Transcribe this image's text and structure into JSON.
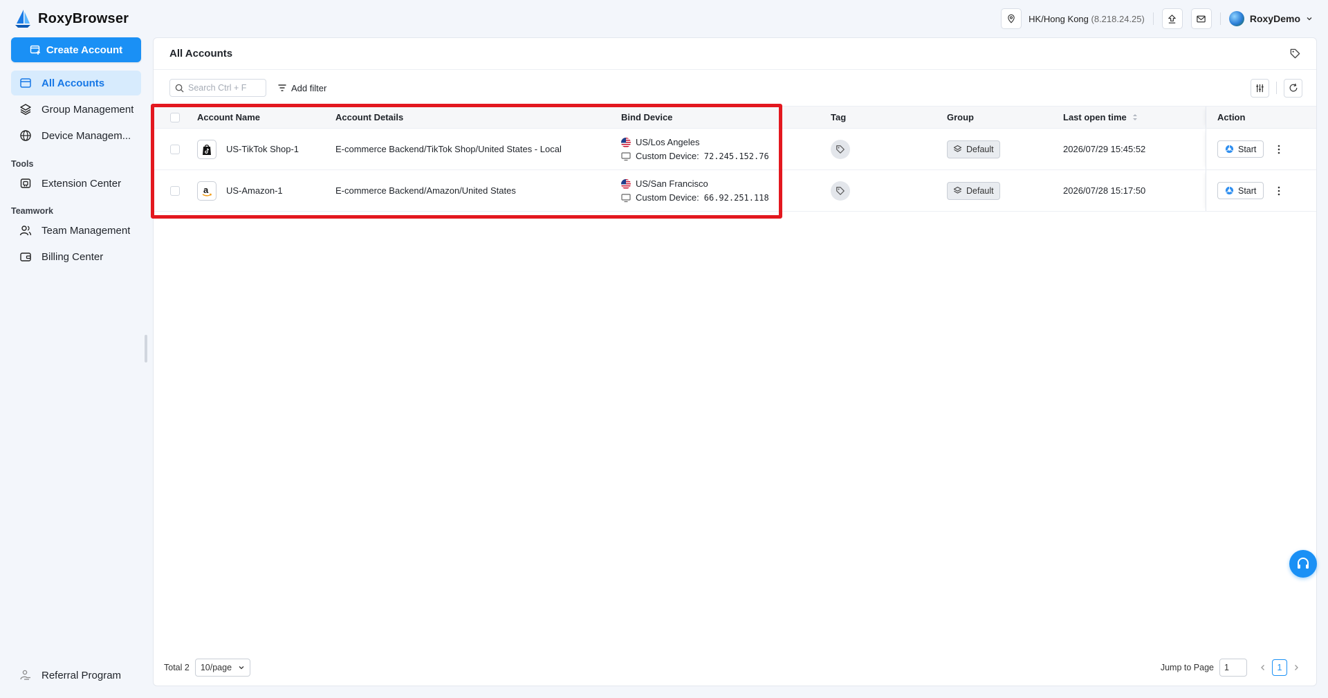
{
  "app": {
    "brand": "RoxyBrowser",
    "accent_color": "#1a90f5",
    "highlight_color": "#e3181f"
  },
  "topbar": {
    "location": "HK/Hong Kong",
    "ip": "(8.218.24.25)",
    "username": "RoxyDemo",
    "icons": [
      "location-pin-icon",
      "upload-icon",
      "mail-icon",
      "globe-avatar",
      "chevron-down-icon"
    ]
  },
  "sidebar": {
    "create_label": "Create Account",
    "items": [
      {
        "label": "All Accounts",
        "icon": "accounts-icon",
        "active": true
      },
      {
        "label": "Group Management",
        "icon": "layers-icon"
      },
      {
        "label": "Device Managem..."
      }
    ],
    "tools_title": "Tools",
    "tools_items": [
      {
        "label": "Extension Center",
        "icon": "extension-icon"
      }
    ],
    "teamwork_title": "Teamwork",
    "teamwork_items": [
      {
        "label": "Team Management",
        "icon": "team-icon"
      },
      {
        "label": "Billing Center",
        "icon": "wallet-icon"
      }
    ],
    "referral_label": "Referral Program"
  },
  "main": {
    "title": "All Accounts",
    "search_placeholder": "Search Ctrl + F",
    "add_filter_label": "Add filter",
    "columns": {
      "name": "Account Name",
      "details": "Account Details",
      "device": "Bind Device",
      "tag": "Tag",
      "group": "Group",
      "last_open": "Last open time",
      "action": "Action"
    },
    "rows": [
      {
        "name": "US-TikTok Shop-1",
        "platform_icon": "tiktok-shop-icon",
        "details": "E-commerce Backend/TikTok Shop/United States - Local",
        "location": "US/Los Angeles",
        "device_label": "Custom Device:",
        "device_ip": "72.245.152.76",
        "group": "Default",
        "last_open": "2026/07/29 15:45:52",
        "start_label": "Start"
      },
      {
        "name": "US-Amazon-1",
        "platform_icon": "amazon-icon",
        "details": "E-commerce Backend/Amazon/United States",
        "location": "US/San Francisco",
        "device_label": "Custom Device:",
        "device_ip": "66.92.251.118",
        "group": "Default",
        "last_open": "2026/07/28 15:17:50",
        "start_label": "Start"
      }
    ]
  },
  "footer": {
    "total_label": "Total 2",
    "page_size": "10/page",
    "jump_label": "Jump to Page",
    "jump_value": "1",
    "current_page": "1"
  }
}
